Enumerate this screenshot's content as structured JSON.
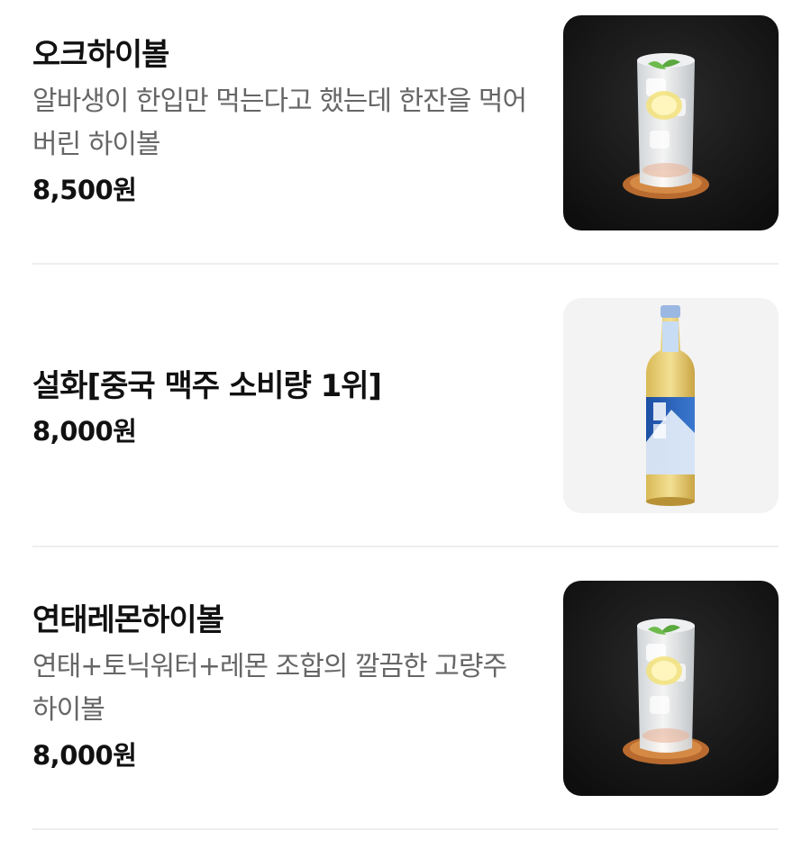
{
  "menu": {
    "items": [
      {
        "name": "오크하이볼",
        "description": "알바생이 한입만 먹는다고 했는데 한잔을 먹어버린 하이볼",
        "price": "8,500원",
        "image": "highball-glass-photo"
      },
      {
        "name": "설화[중국 맥주 소비량 1위]",
        "description": "",
        "price": "8,000원",
        "image": "snow-beer-bottle-photo"
      },
      {
        "name": "연태레몬하이볼",
        "description": "연태+토닉워터+레몬 조합의 깔끔한 고량주 하이볼",
        "price": "8,000원",
        "image": "highball-glass-photo"
      }
    ]
  },
  "colors": {
    "title": "#111111",
    "description": "#666666",
    "divider": "#eeeeee",
    "photo_dark_bg": "#121212",
    "photo_light_bg": "#f3f3f3"
  }
}
